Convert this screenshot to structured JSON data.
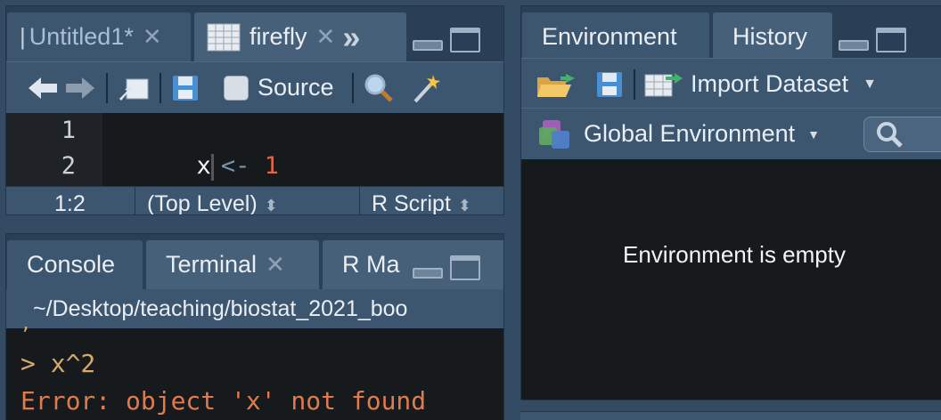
{
  "source_pane": {
    "tabs": [
      {
        "label": "Untitled1*",
        "close": "✕"
      },
      {
        "label": "firefly",
        "close": "✕"
      }
    ],
    "overflow_chevron": "»",
    "toolbar": {
      "source_label": "Source"
    },
    "editor_lines": [
      {
        "num": "1",
        "code_var": "x",
        "code_op": "<-",
        "code_val": "1"
      },
      {
        "num": "2"
      }
    ],
    "status": {
      "position": "1:2",
      "scope": "(Top Level)",
      "file_type": "R Script"
    }
  },
  "console_pane": {
    "tabs": [
      {
        "label": "Console"
      },
      {
        "label": "Terminal",
        "close": "✕"
      },
      {
        "label": "R Ma"
      }
    ],
    "path": "~/Desktop/teaching/biostat_2021_boo",
    "lines": [
      {
        "text": "> x^2",
        "color": "#d7a86e"
      },
      {
        "text": "Error: object 'x' not found",
        "color": "#e27b4c"
      }
    ]
  },
  "env_pane": {
    "tabs": [
      {
        "label": "Environment"
      },
      {
        "label": "History"
      }
    ],
    "toolbar": {
      "import_label": "Import Dataset"
    },
    "scope_label": "Global Environment",
    "empty_message": "Environment is empty"
  },
  "colors": {
    "background": "#344c63",
    "editor_bg": "#171a1d",
    "number_literal": "#e0664a",
    "operator": "#7a93ad"
  }
}
